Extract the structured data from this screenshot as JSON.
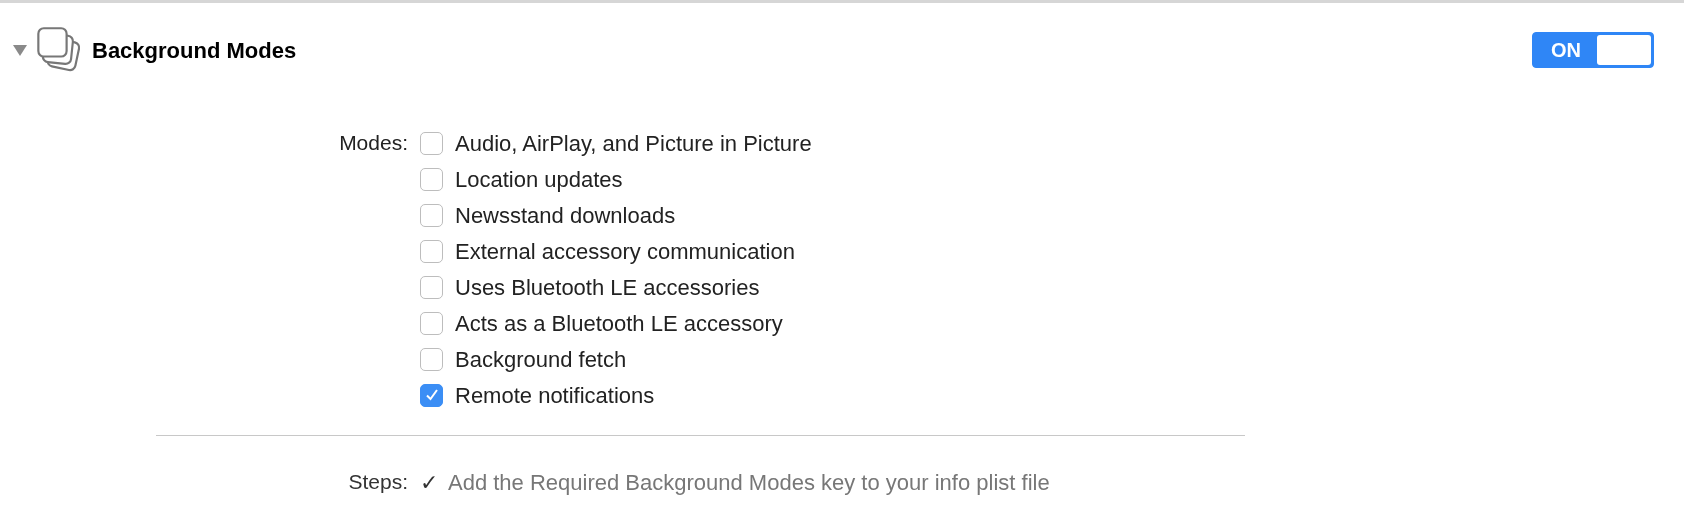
{
  "section": {
    "title": "Background Modes",
    "expanded": true,
    "switch": {
      "label": "ON",
      "on": true
    }
  },
  "modes": {
    "label": "Modes:",
    "items": [
      {
        "label": "Audio, AirPlay, and Picture in Picture",
        "checked": false
      },
      {
        "label": "Location updates",
        "checked": false
      },
      {
        "label": "Newsstand downloads",
        "checked": false
      },
      {
        "label": "External accessory communication",
        "checked": false
      },
      {
        "label": "Uses Bluetooth LE accessories",
        "checked": false
      },
      {
        "label": "Acts as a Bluetooth LE accessory",
        "checked": false
      },
      {
        "label": "Background fetch",
        "checked": false
      },
      {
        "label": "Remote notifications",
        "checked": true
      }
    ]
  },
  "steps": {
    "label": "Steps:",
    "items": [
      {
        "mark": "✓",
        "text": "Add the Required Background Modes key to your info plist file"
      }
    ]
  }
}
